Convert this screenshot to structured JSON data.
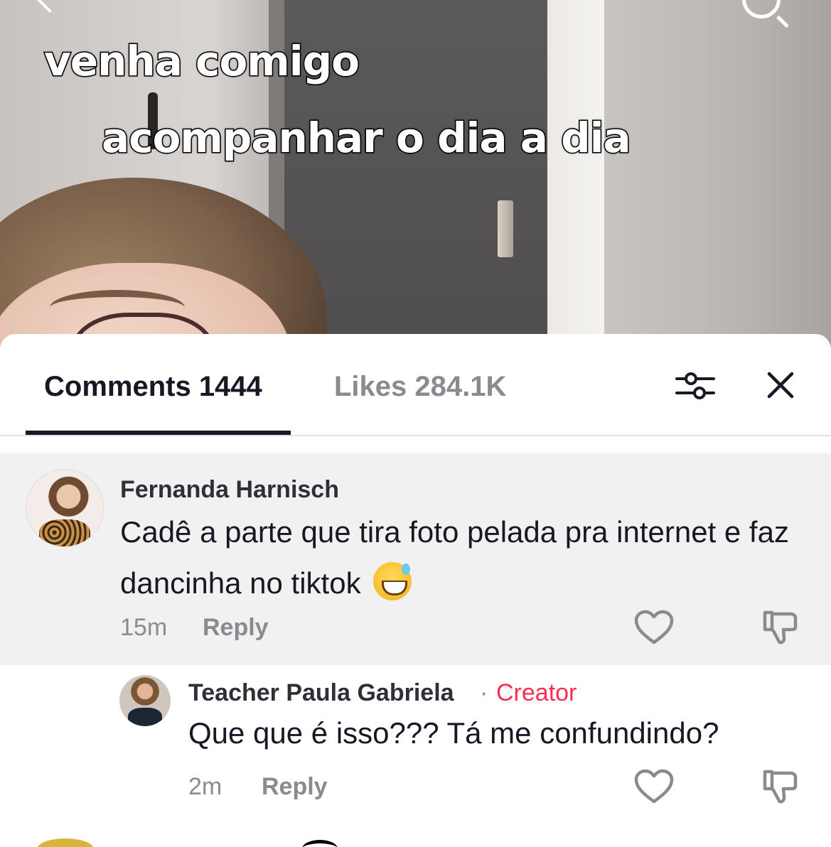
{
  "video": {
    "caption_line1": "venha comigo",
    "caption_line2": "acompanhar o dia a dia"
  },
  "tabs": {
    "comments_label": "Comments 1444",
    "likes_label": "Likes 284.1K"
  },
  "comments": [
    {
      "author": "Fernanda Harnisch",
      "text": "Cadê a parte que tira foto pelada pra internet e faz dancinha no tiktok",
      "emoji": "sweat-smile",
      "time": "15m",
      "reply_label": "Reply"
    },
    {
      "author": "Teacher Paula Gabriela",
      "separator": "·",
      "badge": "Creator",
      "text": "Que que é isso??? Tá me confundindo?",
      "time": "2m",
      "reply_label": "Reply"
    }
  ],
  "colors": {
    "creator_badge": "#fe2c55",
    "primary_text": "#161823",
    "secondary_text": "#8a8b91",
    "highlight_bg": "#f1f1f2"
  },
  "icons": [
    "back-icon",
    "search-icon",
    "filter-icon",
    "close-icon",
    "heart-icon",
    "dislike-icon"
  ]
}
